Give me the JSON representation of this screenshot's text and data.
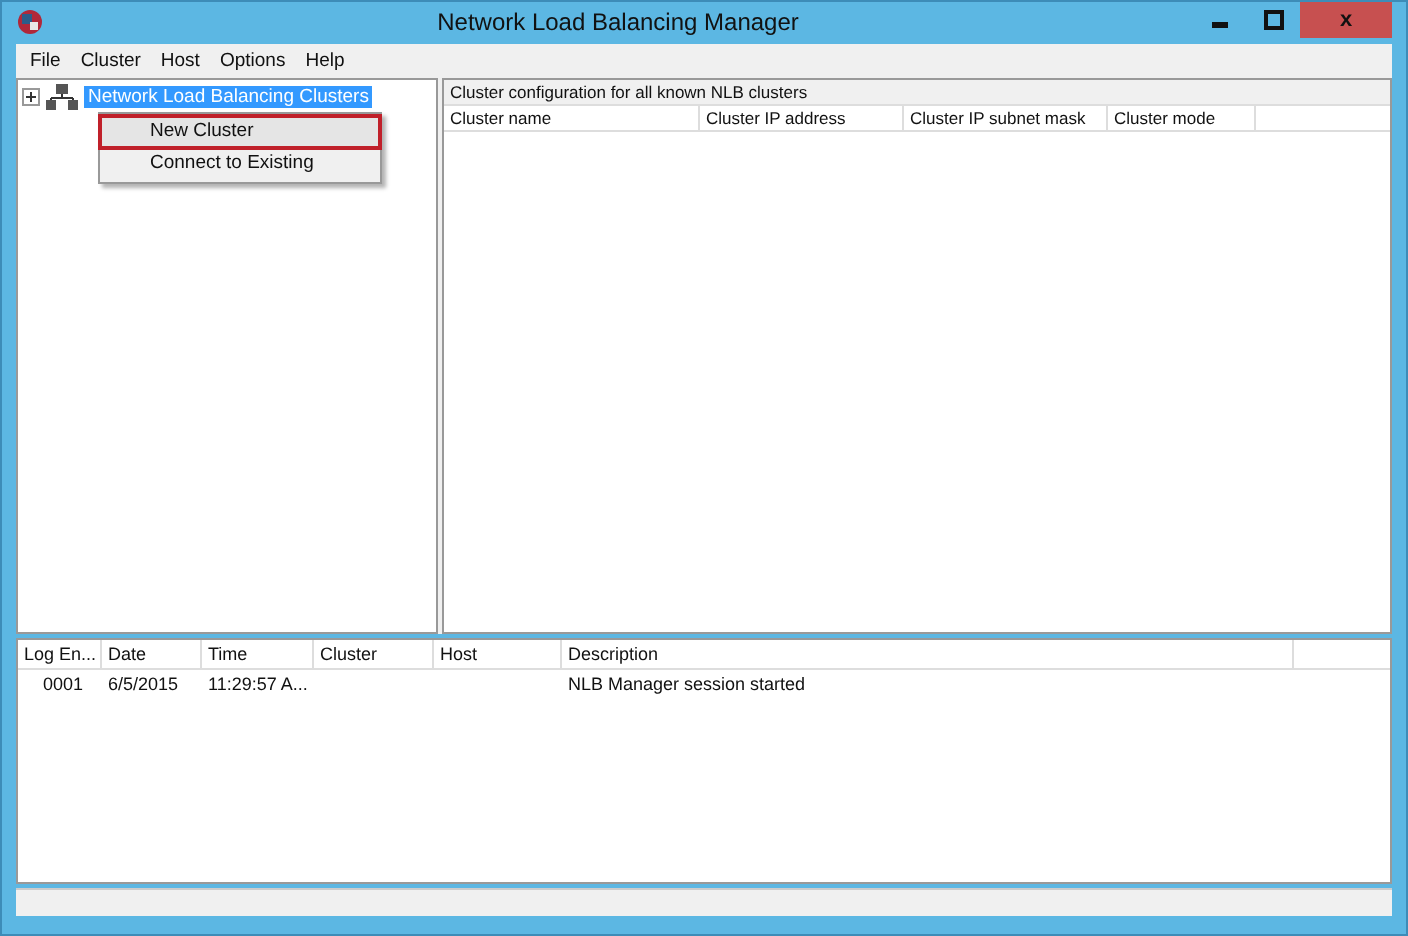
{
  "window": {
    "title": "Network Load Balancing Manager",
    "close_glyph": "x"
  },
  "menu_bar": [
    "File",
    "Cluster",
    "Host",
    "Options",
    "Help"
  ],
  "tree": {
    "items": [
      {
        "label": "Network Load Balancing Clusters",
        "selected": true,
        "expanded": false
      }
    ]
  },
  "context_menu": {
    "items": [
      {
        "label": "New Cluster",
        "selected": true
      },
      {
        "label": "Connect to Existing",
        "selected": false
      }
    ]
  },
  "cluster_panel": {
    "caption": "Cluster configuration for all known NLB clusters",
    "columns": [
      "Cluster name",
      "Cluster IP address",
      "Cluster IP subnet mask",
      "Cluster mode"
    ]
  },
  "log": {
    "columns": [
      "Log En...",
      "Date",
      "Time",
      "Cluster",
      "Host",
      "Description"
    ],
    "rows": [
      [
        "0001",
        "6/5/2015",
        "11:29:57 A...",
        "",
        "",
        "NLB Manager session started"
      ]
    ]
  }
}
